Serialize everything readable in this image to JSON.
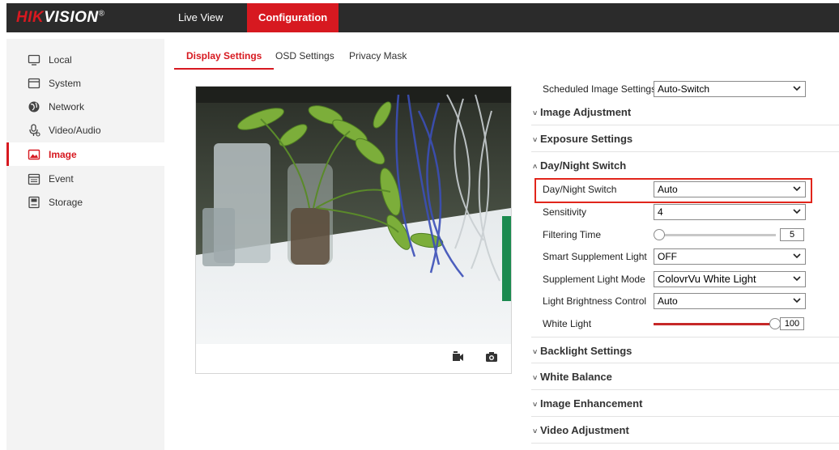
{
  "brand": {
    "name_red": "HIK",
    "name_white": "VISION",
    "reg": "®"
  },
  "nav": {
    "live_view": "Live View",
    "configuration": "Configuration"
  },
  "sidebar": {
    "items": [
      {
        "label": "Local",
        "icon": "monitor-icon"
      },
      {
        "label": "System",
        "icon": "system-icon"
      },
      {
        "label": "Network",
        "icon": "globe-icon"
      },
      {
        "label": "Video/Audio",
        "icon": "microphone-icon"
      },
      {
        "label": "Image",
        "icon": "image-icon",
        "active": true
      },
      {
        "label": "Event",
        "icon": "calendar-icon"
      },
      {
        "label": "Storage",
        "icon": "storage-icon"
      }
    ]
  },
  "tabs": {
    "display": "Display Settings",
    "osd": "OSD Settings",
    "privacy": "Privacy Mask"
  },
  "settings": {
    "scheduled_label": "Scheduled Image Settings",
    "scheduled_value": "Auto-Switch",
    "sections": {
      "image_adjustment": "Image Adjustment",
      "exposure": "Exposure Settings",
      "day_night": "Day/Night Switch",
      "backlight": "Backlight Settings",
      "white_balance": "White Balance",
      "enhancement": "Image Enhancement",
      "video_adjustment": "Video Adjustment"
    },
    "day_night_label": "Day/Night Switch",
    "day_night_value": "Auto",
    "sensitivity_label": "Sensitivity",
    "sensitivity_value": "4",
    "filtering_label": "Filtering Time",
    "filtering_value": "5",
    "smart_label": "Smart Supplement Light",
    "smart_value": "OFF",
    "mode_label": "Supplement Light Mode",
    "mode_value": "ColovrVu White Light",
    "brightness_label": "Light Brightness Control",
    "brightness_value": "Auto",
    "white_label": "White Light",
    "white_value": "100",
    "white_level_percent": 100,
    "filtering_level_percent": 0
  },
  "colors": {
    "accent": "#d71920",
    "topbar": "#2b2b2b",
    "sidebar": "#f3f3f3",
    "highlight": "#e1251b"
  }
}
